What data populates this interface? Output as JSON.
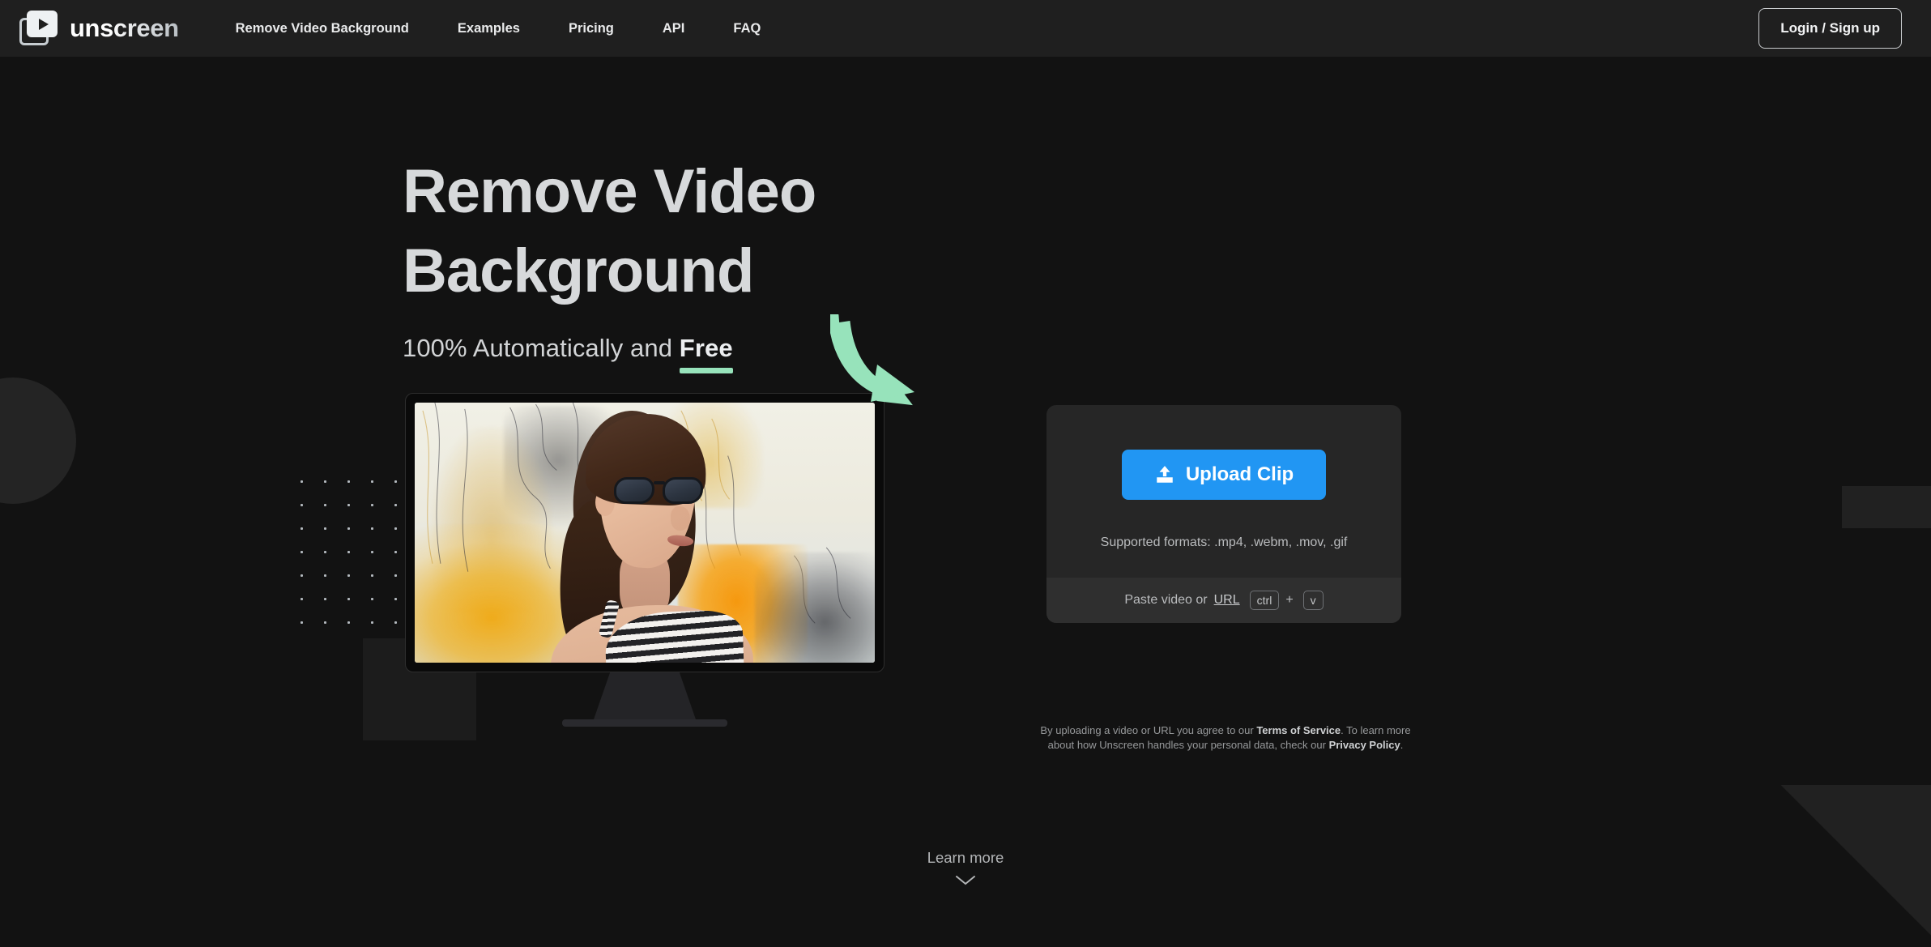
{
  "brand": {
    "name": "unscreen",
    "logo_icon": "play-video-icon"
  },
  "nav": {
    "items": [
      {
        "label": "Remove Video Background"
      },
      {
        "label": "Examples"
      },
      {
        "label": "Pricing"
      },
      {
        "label": "API"
      },
      {
        "label": "FAQ"
      }
    ],
    "login_label": "Login / Sign up"
  },
  "hero": {
    "title_line1": "Remove Video",
    "title_line2": "Background",
    "subtitle_prefix": "100% Automatically and ",
    "subtitle_highlight": "Free",
    "highlight_color": "#97e3bb"
  },
  "upload": {
    "button_label": "Upload Clip",
    "button_icon": "upload-icon",
    "button_color": "#2196f3",
    "supported_formats": "Supported formats: .mp4, .webm, .mov, .gif",
    "paste_prefix": "Paste video or ",
    "paste_link": "URL",
    "key_ctrl": "ctrl",
    "key_plus": "+",
    "key_v": "v"
  },
  "legal": {
    "line1_prefix": "By uploading a video or URL you agree to our ",
    "terms_label": "Terms of Service",
    "line1_suffix": ". To learn more about",
    "line2_prefix": "how Unscreen handles your personal data, check our ",
    "privacy_label": "Privacy Policy",
    "line2_suffix": "."
  },
  "learn_more": {
    "label": "Learn more",
    "icon": "chevron-down-icon"
  },
  "decor": {
    "arrow_icon": "curved-arrow-icon",
    "arrow_color": "#97e3bb",
    "dot_grid": "dot-grid-pattern",
    "preview_alt": "video-preview-woman-sunglasses"
  },
  "theme": {
    "page_bg": "#121212",
    "header_bg": "#1f1f1f",
    "card_bg": "#262626",
    "card_footer_bg": "#2f2f2f"
  }
}
